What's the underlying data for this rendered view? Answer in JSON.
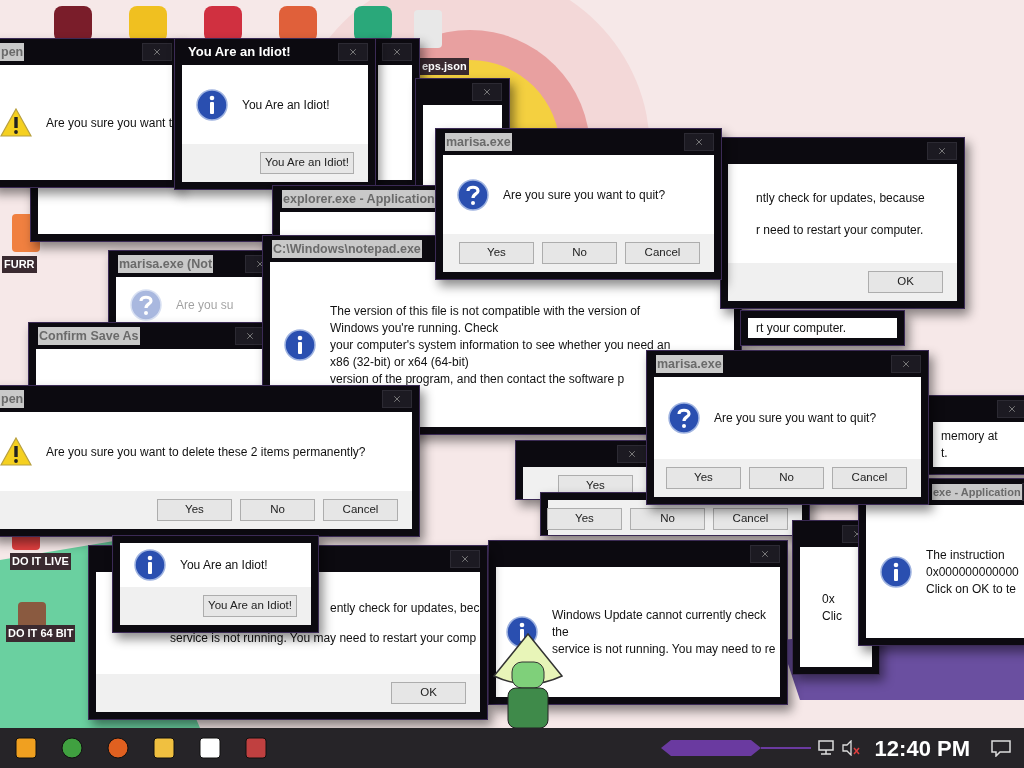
{
  "desktop_icons": [
    {
      "label": "eps.json"
    },
    {
      "label": "FURR"
    },
    {
      "label": "DO IT LIVE"
    },
    {
      "label": "DO IT 64 BIT"
    }
  ],
  "windows": [
    {
      "kind": "plain"
    },
    {
      "kind": "warning",
      "title": "pen",
      "lines": [
        "Are you sure you want t"
      ]
    },
    {
      "kind": "plain"
    },
    {
      "kind": "plain"
    },
    {
      "kind": "info",
      "title": "You Are an Idiot!",
      "lines": [
        "You Are an Idiot!"
      ],
      "buttons": [
        "You Are an Idiot!"
      ]
    },
    {
      "kind": "plain",
      "title": "explorer.exe - Application"
    },
    {
      "kind": "question",
      "title": "marisa.exe (Not",
      "lines": [
        "Are you su"
      ],
      "dimmed": true
    },
    {
      "kind": "plain",
      "title": "Confirm Save As"
    },
    {
      "kind": "info",
      "title": "C:\\Windows\\notepad.exe",
      "lines": [
        "The version of this file is not compatible with the version of",
        "Windows you're running. Check",
        "your computer's system information to see whether you need an",
        "x86 (32-bit) or x64 (64-bit)",
        "version of the program, and then contact the software p"
      ]
    },
    {
      "kind": "plain",
      "lines": [
        "ntly check for updates, because",
        "r need to restart your computer."
      ],
      "buttons": [
        "OK"
      ]
    },
    {
      "kind": "plain",
      "lines": [
        "rt your computer."
      ]
    },
    {
      "kind": "question",
      "title": "marisa.exe",
      "lines": [
        "Are you sure you want to quit?"
      ],
      "buttons": [
        "Yes",
        "No",
        "Cancel"
      ]
    },
    {
      "kind": "plain",
      "buttons": [
        "Yes"
      ]
    },
    {
      "kind": "plain",
      "buttons": [
        "Yes",
        "No",
        "Cancel"
      ]
    },
    {
      "kind": "warning",
      "title": "pen",
      "lines": [
        "Are you sure you want to delete these 2 items permanently?"
      ],
      "buttons": [
        "Yes",
        "No",
        "Cancel"
      ]
    },
    {
      "kind": "plain",
      "lines": [
        "memory at",
        "t."
      ]
    },
    {
      "kind": "info",
      "lines": [
        "Windows Update cannot currently check",
        "the",
        "service is not running. You may need to re"
      ]
    },
    {
      "kind": "plain",
      "lines": [
        "0x",
        "Clic"
      ]
    },
    {
      "kind": "info",
      "title": "exe - Application",
      "lines": [
        "The instruction",
        "0x000000000000",
        "Click on OK to te"
      ]
    },
    {
      "kind": "question",
      "title": "marisa.exe",
      "lines": [
        "Are you sure you want to quit?"
      ],
      "buttons": [
        "Yes",
        "No",
        "Cancel"
      ]
    },
    {
      "kind": "plain",
      "lines": [
        "ently check for updates, bec",
        "service is not running. You may need to restart your comp"
      ],
      "buttons": [
        "OK"
      ]
    },
    {
      "kind": "info",
      "lines": [
        "You Are an Idiot!"
      ],
      "buttons": [
        "You Are an Idiot!"
      ]
    }
  ],
  "taskbar": {
    "clock": "12:40 PM"
  }
}
